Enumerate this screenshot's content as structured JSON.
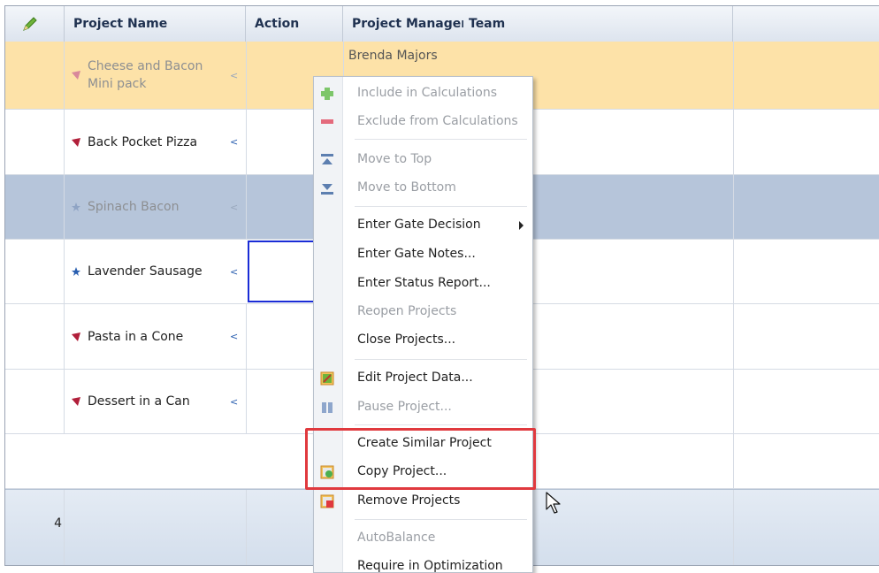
{
  "grid": {
    "columns": [
      "Project Name",
      "Action",
      "Project Manager",
      "Team"
    ],
    "rows": [
      {
        "name": "Cheese and Bacon Mini pack",
        "manager": "Brenda Majors",
        "state": "selected-orange"
      },
      {
        "name": "Back Pocket Pizza",
        "manager": "",
        "state": "normal"
      },
      {
        "name": "Spinach Bacon",
        "manager": "",
        "state": "selected-blue"
      },
      {
        "name": "Lavender Sausage",
        "manager": "",
        "state": "normal"
      },
      {
        "name": "Pasta in a Cone",
        "manager": "",
        "state": "normal"
      },
      {
        "name": "Dessert in a Can",
        "manager": "",
        "state": "normal"
      }
    ],
    "footer_count": "4"
  },
  "context_menu": {
    "items": [
      {
        "label": "Include in Calculations",
        "disabled": true,
        "icon": "plus-icon"
      },
      {
        "label": "Exclude from Calculations",
        "disabled": true,
        "icon": "minus-icon"
      },
      {
        "label": "Move to Top",
        "disabled": true,
        "icon": "move-top-icon"
      },
      {
        "label": "Move to Bottom",
        "disabled": true,
        "icon": "move-bottom-icon"
      },
      {
        "label": "Enter Gate Decision",
        "disabled": false,
        "submenu": true
      },
      {
        "label": "Enter Gate Notes...",
        "disabled": false
      },
      {
        "label": "Enter Status Report...",
        "disabled": false
      },
      {
        "label": "Reopen Projects",
        "disabled": true
      },
      {
        "label": "Close Projects...",
        "disabled": false
      },
      {
        "label": "Edit Project Data...",
        "disabled": false,
        "icon": "edit-data-icon"
      },
      {
        "label": "Pause Project...",
        "disabled": true,
        "icon": "pause-icon"
      },
      {
        "label": "Create Similar Project",
        "disabled": false
      },
      {
        "label": "Copy Project...",
        "disabled": false,
        "icon": "copy-project-icon"
      },
      {
        "label": "Remove Projects",
        "disabled": false,
        "icon": "remove-projects-icon"
      },
      {
        "label": "AutoBalance",
        "disabled": true
      },
      {
        "label": "Require in Optimization",
        "disabled": false
      }
    ]
  },
  "colors": {
    "row_selected_orange": "#fde2a8",
    "row_selected_blue": "#b6c5da",
    "highlight_box": "#e0393e",
    "focus_cell": "#1a2cd6"
  }
}
